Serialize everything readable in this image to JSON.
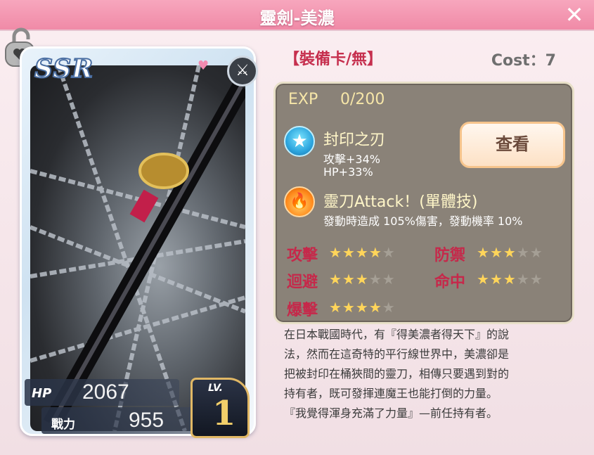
{
  "title": "靈劍-美濃",
  "equip_type": "【裝備卡/無】",
  "cost": "Cost：7",
  "card": {
    "rarity": "SSR",
    "hp_label": "HP",
    "hp_value": "2067",
    "power_label": "戰力",
    "power_value": "955",
    "lv_label": "LV.",
    "lv_value": "1"
  },
  "exp": {
    "label": "EXP",
    "value": "0/200"
  },
  "skill1": {
    "name": "封印之刃",
    "line1": "攻擊+34%",
    "line2": "HP+33%"
  },
  "view_button": "查看",
  "skill2": {
    "name": "靈刀Attack！(單體技)",
    "desc": "發動時造成 105%傷害，發動機率 10%"
  },
  "stats": [
    {
      "label": "攻擊",
      "stars": 4
    },
    {
      "label": "防禦",
      "stars": 3
    },
    {
      "label": "迴避",
      "stars": 3
    },
    {
      "label": "命中",
      "stars": 3
    },
    {
      "label": "爆擊",
      "stars": 4
    }
  ],
  "description": [
    "在日本戰國時代，有『得美濃者得天下』的說",
    "法，然而在這奇特的平行線世界中，美濃卻是",
    "把被封印在桶狹間的靈刀，相傳只要遇到對的",
    "持有者，既可發揮連魔王也能打倒的力量。",
    "『我覺得渾身充滿了力量』—前任持有者。"
  ],
  "colors": {
    "header": "#f08aa7",
    "accent_red": "#c62f4e",
    "panel": "#8a8278",
    "star_on": "#ffd55a",
    "star_off": "#a59f95"
  },
  "icons": {
    "close": "close-icon",
    "lock": "lock-heart-icon",
    "type": "sword-type-icon",
    "skill1": "star-skill-icon",
    "skill2": "flame-skill-icon"
  }
}
